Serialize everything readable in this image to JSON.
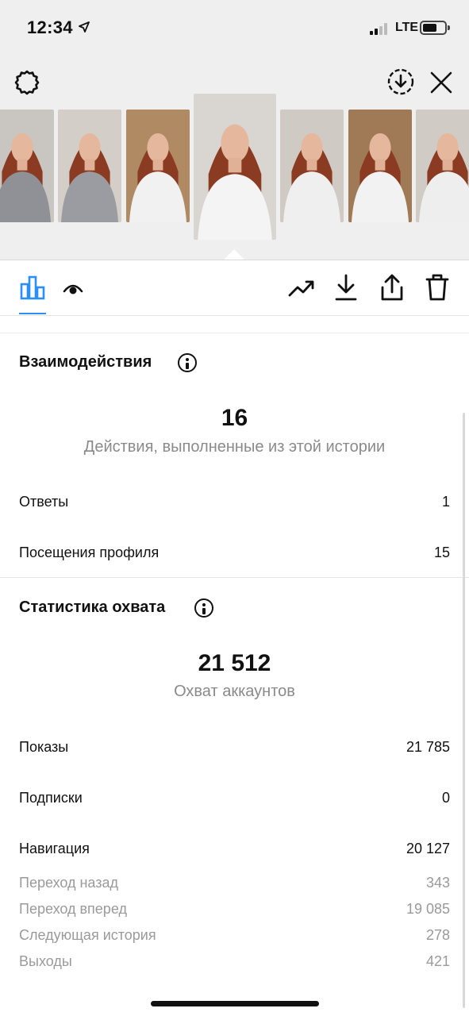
{
  "status_bar": {
    "time": "12:34",
    "network": "LTE"
  },
  "thumbnails": [
    {
      "name": "story-thumb-1",
      "bg": "#c9c5c0",
      "shirt": "#8f9197"
    },
    {
      "name": "story-thumb-2",
      "bg": "#d3cec7",
      "shirt": "#9a9ca2"
    },
    {
      "name": "story-thumb-3",
      "bg": "#b08a63",
      "shirt": "#f1f1f1"
    },
    {
      "name": "story-thumb-4",
      "bg": "#d9d6d2",
      "shirt": "#f4f4f4"
    },
    {
      "name": "story-thumb-5",
      "bg": "#cfcac4",
      "shirt": "#efefef"
    },
    {
      "name": "story-thumb-6",
      "bg": "#a07a56",
      "shirt": "#f2f2f2"
    },
    {
      "name": "story-thumb-7",
      "bg": "#d0cbc5",
      "shirt": "#eeeeee"
    }
  ],
  "interactions": {
    "title": "Взаимодействия",
    "total": "16",
    "caption": "Действия, выполненные из этой истории",
    "rows": [
      {
        "label": "Ответы",
        "value": "1"
      },
      {
        "label": "Посещения профиля",
        "value": "15"
      }
    ]
  },
  "reach": {
    "title": "Статистика охвата",
    "total": "21 512",
    "caption": "Охват аккаунтов",
    "rows": [
      {
        "label": "Показы",
        "value": "21 785"
      },
      {
        "label": "Подписки",
        "value": "0"
      },
      {
        "label": "Навигация",
        "value": "20 127"
      }
    ],
    "navigation_rows": [
      {
        "label": "Переход назад",
        "value": "343"
      },
      {
        "label": "Переход вперед",
        "value": "19 085"
      },
      {
        "label": "Следующая история",
        "value": "278"
      },
      {
        "label": "Выходы",
        "value": "421"
      }
    ]
  },
  "colors": {
    "accent": "#2b8ff6",
    "muted": "#8a8a8a"
  }
}
